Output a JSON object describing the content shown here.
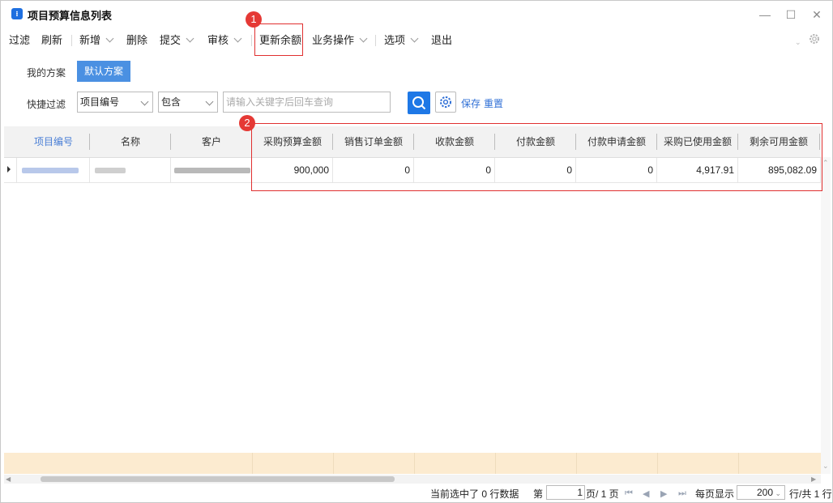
{
  "window": {
    "title": "项目预算信息列表",
    "controls": {
      "minimize": "—",
      "maximize": "☐",
      "close": "✕"
    }
  },
  "toolbar": {
    "items": [
      {
        "label": "过滤"
      },
      {
        "label": "刷新"
      },
      {
        "label": "新增"
      },
      {
        "label": "删除"
      },
      {
        "label": "提交"
      },
      {
        "label": "审核"
      },
      {
        "label": "更新余额"
      },
      {
        "label": "业务操作"
      },
      {
        "label": "选项"
      },
      {
        "label": "退出"
      }
    ]
  },
  "annotations": {
    "badge1": "1",
    "badge2": "2"
  },
  "schemes": {
    "my_label": "我的方案",
    "default_label": "默认方案"
  },
  "filter": {
    "label": "快捷过滤",
    "field": "项目编号",
    "operator": "包含",
    "placeholder": "请输入关键字后回车查询",
    "save": "保存",
    "reset": "重置"
  },
  "table": {
    "headers": [
      "项目编号",
      "名称",
      "客户",
      "采购预算金额",
      "销售订单金额",
      "收款金额",
      "付款金额",
      "付款申请金额",
      "采购已使用金额",
      "剩余可用金额"
    ],
    "rows": [
      {
        "values": [
          "900,000",
          "0",
          "0",
          "0",
          "0",
          "4,917.91",
          "895,082.09"
        ]
      }
    ]
  },
  "status": {
    "selected": "当前选中了 0 行数据",
    "page_prefix": "第",
    "page_value": "1",
    "page_suffix": "页/ 1 页",
    "per_page_label": "每页显示",
    "per_page_value": "200",
    "total": "行/共 1 行"
  },
  "colors": {
    "accent": "#1e78e6",
    "highlight": "#e03030",
    "header_link": "#4a7fd6",
    "summary_band": "#fcebd0"
  }
}
